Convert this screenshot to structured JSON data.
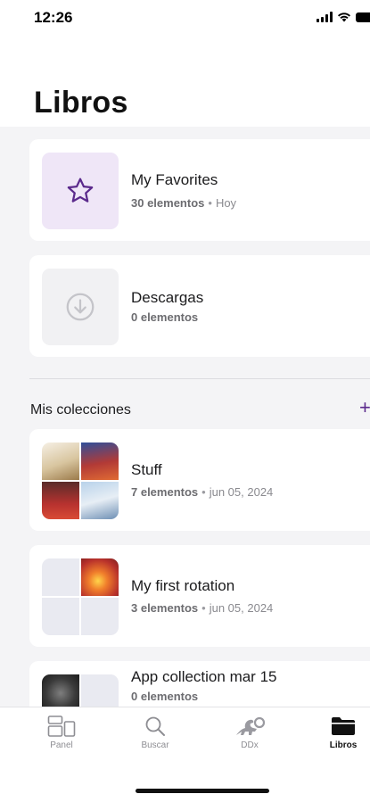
{
  "status_bar": {
    "time": "12:26"
  },
  "header": {
    "title": "Libros"
  },
  "favorites": {
    "title": "My Favorites",
    "count": "30 elementos",
    "separator": "•",
    "date": "Hoy"
  },
  "downloads": {
    "title": "Descargas",
    "count": "0 elementos"
  },
  "collections": {
    "section_title": "Mis colecciones",
    "add_label": "+",
    "items": [
      {
        "title": "Stuff",
        "count": "7 elementos",
        "separator": "•",
        "date": "jun 05, 2024"
      },
      {
        "title": "My first rotation",
        "count": "3 elementos",
        "separator": "•",
        "date": "jun 05, 2024"
      },
      {
        "title": "App collection mar 15",
        "count": "0 elementos"
      }
    ]
  },
  "tab_bar": {
    "items": [
      {
        "label": "Panel",
        "icon": "panel-icon"
      },
      {
        "label": "Buscar",
        "icon": "search-icon"
      },
      {
        "label": "DDx",
        "icon": "ddx-dinosaur-icon"
      },
      {
        "label": "Libros",
        "icon": "folder-icon",
        "active": true
      }
    ]
  },
  "colors": {
    "accent": "#5b2a8c",
    "favorites_bg": "#efe6f7",
    "active_tab": "#111111",
    "inactive_tab": "#8e8e93"
  }
}
